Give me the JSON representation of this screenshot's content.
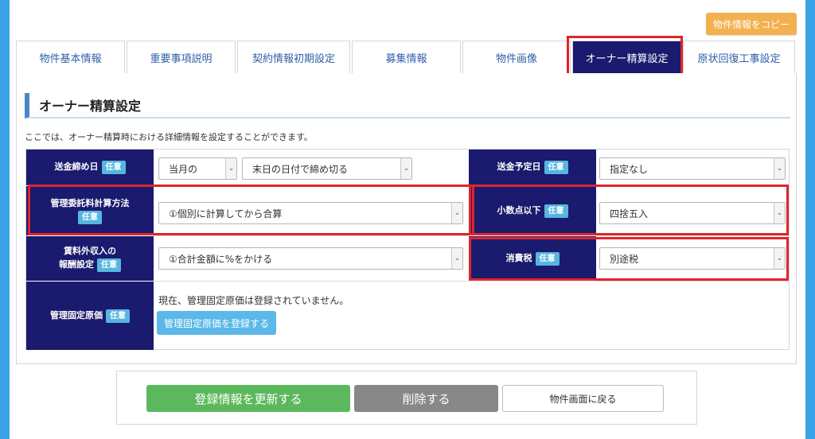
{
  "header": {
    "copy_button": "物件情報をコピー"
  },
  "tabs": [
    {
      "label": "物件基本情報"
    },
    {
      "label": "重要事項説明"
    },
    {
      "label": "契約情報初期設定"
    },
    {
      "label": "募集情報"
    },
    {
      "label": "物件画像"
    },
    {
      "label": "オーナー精算設定"
    },
    {
      "label": "原状回復工事設定"
    }
  ],
  "section": {
    "title": "オーナー精算設定",
    "description": "ここでは、オーナー精算時における詳細情報を設定することができます。"
  },
  "badge": "任意",
  "fields": {
    "closing_day": {
      "label": "送金締め日",
      "month": "当月の",
      "day": "末日の日付で締め切る"
    },
    "send_date": {
      "label": "送金予定日",
      "value": "指定なし"
    },
    "fee_method": {
      "label": "管理委託料計算方法",
      "value": "①個別に計算してから合算"
    },
    "decimal": {
      "label": "小数点以下",
      "value": "四捨五入"
    },
    "non_rent": {
      "label_line1": "賃料外収入の",
      "label_line2": "報酬設定",
      "value": "①合計金額に%をかける"
    },
    "tax": {
      "label": "消費税",
      "value": "別途税"
    },
    "fixed_cost": {
      "label": "管理固定原価",
      "status_text": "現在、管理固定原価は登録されていません。",
      "register_button": "管理固定原価を登録する"
    }
  },
  "footer": {
    "update_button": "登録情報を更新する",
    "delete_button": "削除する",
    "back_button": "物件画面に戻る"
  },
  "colors": {
    "label_bg": "#1a1a6e",
    "badge": "#56b6e0",
    "highlight": "#e0242c",
    "update": "#5cb85c",
    "delete": "#888888",
    "copy": "#f3b04f"
  }
}
